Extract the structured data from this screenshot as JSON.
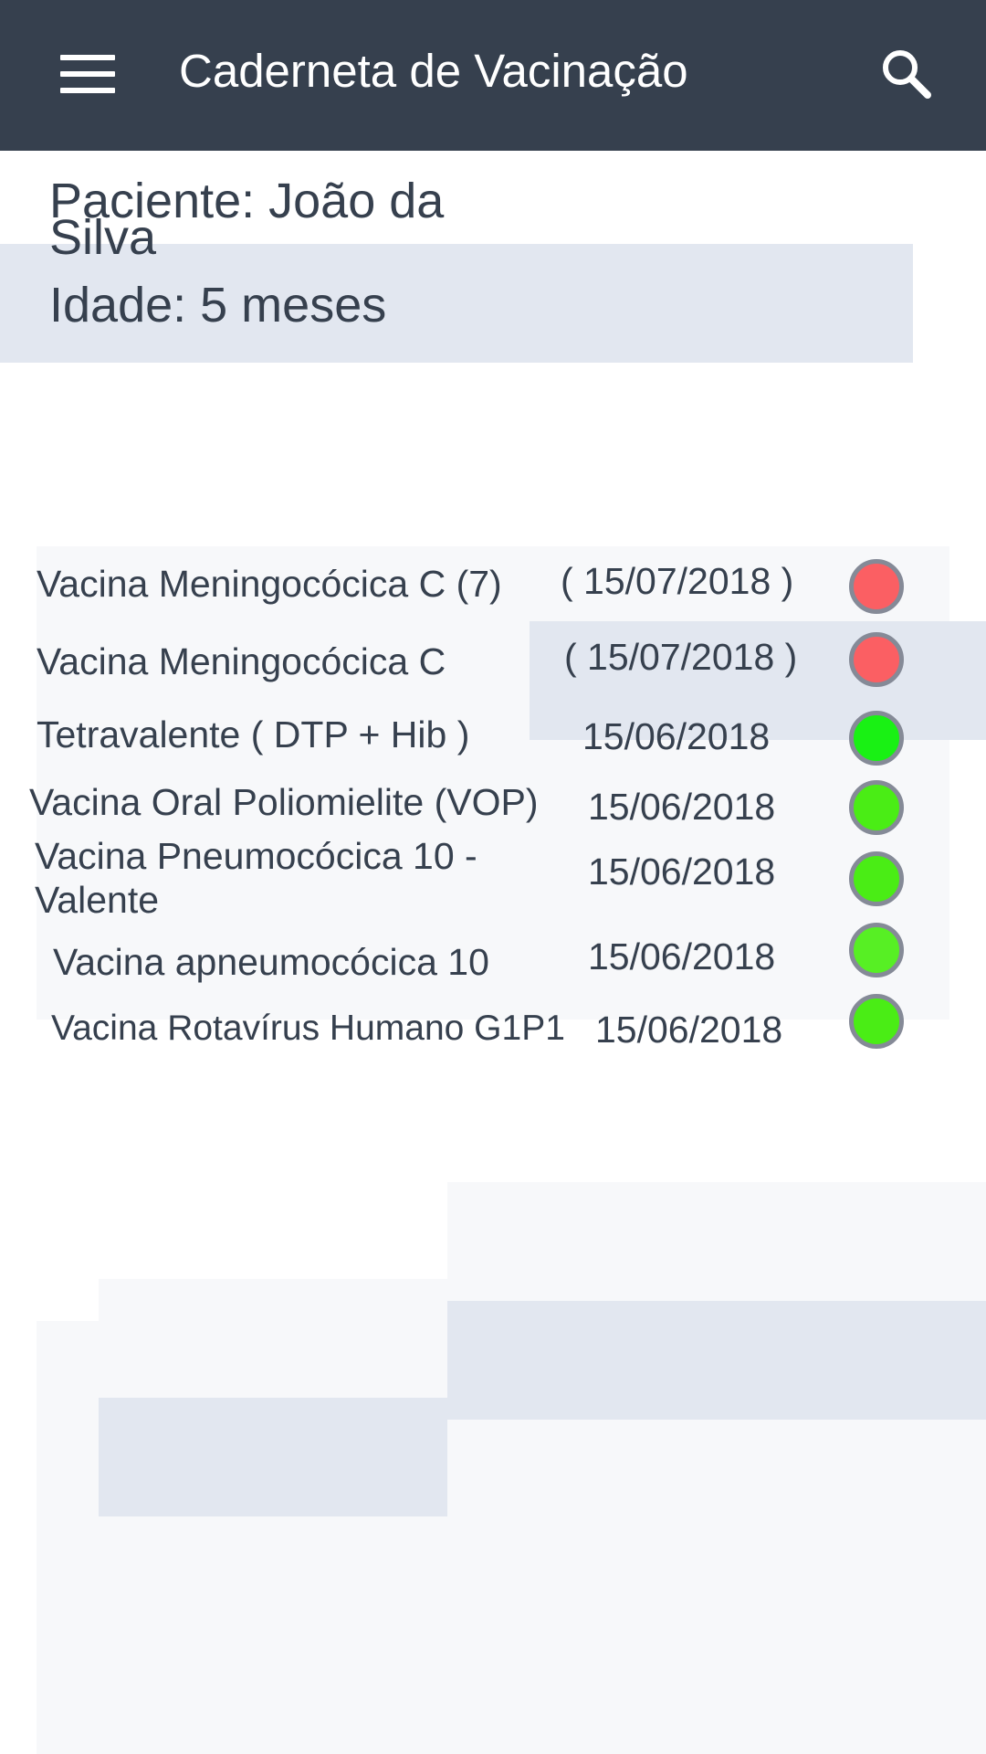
{
  "appbar": {
    "title": "Caderneta de Vacinação",
    "menu_icon": "menu-icon",
    "search_icon": "search-icon",
    "background": "#36404e"
  },
  "patient": {
    "name": "Paciente: João da Silva",
    "age": "Idade: 5 meses"
  },
  "vaccines": [
    {
      "name": "Vacina Meningocócica C (7)",
      "date": "( 15/07/2018 )",
      "status": "pending",
      "color": "#fb5f63"
    },
    {
      "name": "Vacina  Meningocócica C",
      "date": "( 15/07/2018 )",
      "status": "pending",
      "color": "#fb5f63"
    },
    {
      "name": "Tetravalente ( DTP + Hib )",
      "date": "15/06/2018",
      "status": "done",
      "color": "#19f114"
    },
    {
      "name": "Vacina Oral Poliomielite (VOP)",
      "date": "15/06/2018",
      "status": "done",
      "color": "#4aed15"
    },
    {
      "name": "Vacina Pneumocócica 10 - Valente",
      "date": "15/06/2018",
      "status": "done",
      "color": "#4aed15"
    },
    {
      "name": "Vacina apneumocócica 10",
      "date": "15/06/2018",
      "status": "done",
      "color": "#57ef24"
    },
    {
      "name": "Vacina Rotavírus Humano G1P1",
      "date": "15/06/2018",
      "status": "done",
      "color": "#4aed15"
    }
  ]
}
